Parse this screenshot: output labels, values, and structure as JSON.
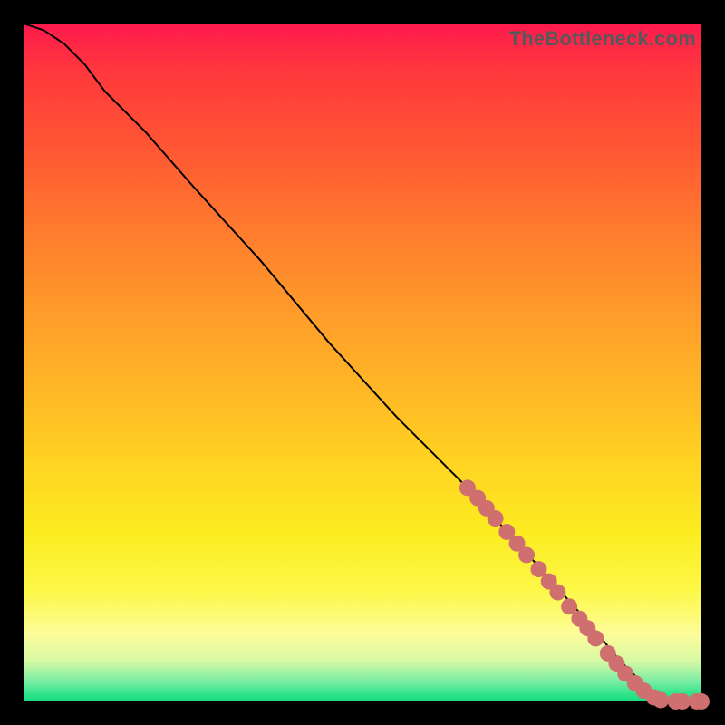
{
  "watermark": "TheBottleneck.com",
  "colors": {
    "dot": "#cf6f6f",
    "curve": "#000000",
    "background": "#000000"
  },
  "chart_data": {
    "type": "line",
    "title": "",
    "xlabel": "",
    "ylabel": "",
    "xlim": [
      0,
      100
    ],
    "ylim": [
      0,
      100
    ],
    "grid": false,
    "legend": false,
    "series": [
      {
        "name": "curve",
        "x": [
          0,
          3,
          6,
          9,
          12,
          18,
          25,
          35,
          45,
          55,
          65,
          75,
          83,
          88,
          92,
          96,
          98,
          100
        ],
        "values": [
          100,
          99,
          97,
          94,
          90,
          84,
          76,
          65,
          53,
          42,
          32,
          21,
          12,
          6,
          2,
          0,
          0,
          0
        ]
      }
    ],
    "markers": {
      "comment": "salmon emphasis dots along the tail of the curve",
      "points": [
        {
          "x": 65.5,
          "y": 31.5
        },
        {
          "x": 67.0,
          "y": 30.0
        },
        {
          "x": 68.3,
          "y": 28.5
        },
        {
          "x": 69.6,
          "y": 27.0
        },
        {
          "x": 71.3,
          "y": 25.0
        },
        {
          "x": 72.8,
          "y": 23.3
        },
        {
          "x": 74.2,
          "y": 21.6
        },
        {
          "x": 76.0,
          "y": 19.5
        },
        {
          "x": 77.5,
          "y": 17.7
        },
        {
          "x": 78.8,
          "y": 16.1
        },
        {
          "x": 80.5,
          "y": 14.0
        },
        {
          "x": 82.0,
          "y": 12.2
        },
        {
          "x": 83.2,
          "y": 10.8
        },
        {
          "x": 84.4,
          "y": 9.3
        },
        {
          "x": 86.2,
          "y": 7.1
        },
        {
          "x": 87.5,
          "y": 5.6
        },
        {
          "x": 88.8,
          "y": 4.1
        },
        {
          "x": 90.2,
          "y": 2.7
        },
        {
          "x": 91.5,
          "y": 1.6
        },
        {
          "x": 93.0,
          "y": 0.6
        },
        {
          "x": 94.0,
          "y": 0.2
        },
        {
          "x": 96.2,
          "y": 0.0
        },
        {
          "x": 97.2,
          "y": 0.0
        },
        {
          "x": 99.3,
          "y": 0.0
        },
        {
          "x": 100.0,
          "y": 0.0
        }
      ],
      "radius_data_units": 1.2
    }
  }
}
